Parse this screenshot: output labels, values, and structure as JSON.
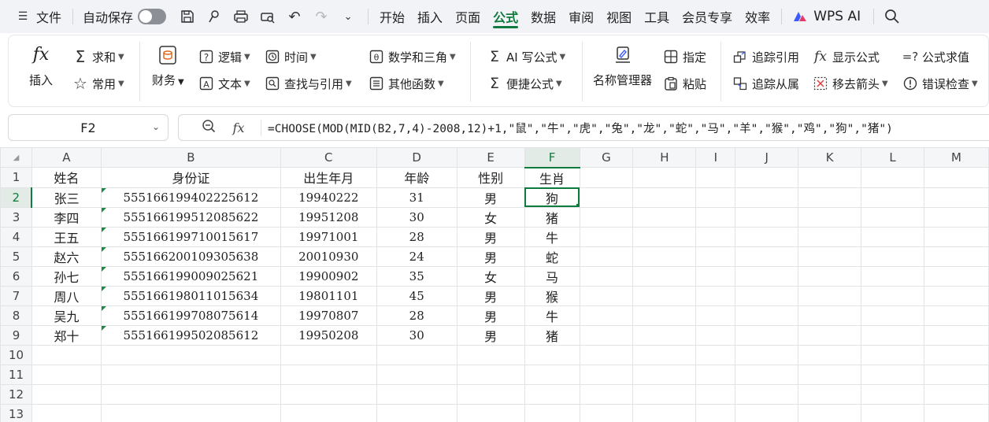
{
  "menubar": {
    "file_label": "文件",
    "autosave_label": "自动保存",
    "tabs": [
      "开始",
      "插入",
      "页面",
      "公式",
      "数据",
      "审阅",
      "视图",
      "工具",
      "会员专享",
      "效率"
    ],
    "active_tab": "公式",
    "wps_ai_label": "WPS AI"
  },
  "ribbon": {
    "insert_label": "插入",
    "sum_label": "求和",
    "common_label": "常用",
    "finance_label": "财务",
    "logic_label": "逻辑",
    "text_label": "文本",
    "time_label": "时间",
    "lookup_label": "查找与引用",
    "math_label": "数学和三角",
    "other_label": "其他函数",
    "ai_formula_label": "AI 写公式",
    "quick_formula_label": "便捷公式",
    "name_manager_label": "名称管理器",
    "specify_label": "指定",
    "paste_label": "粘贴",
    "trace_precedents_label": "追踪引用",
    "trace_dependents_label": "追踪从属",
    "show_formula_label": "显示公式",
    "remove_arrows_label": "移去箭头",
    "eval_formula_label": "公式求值",
    "error_check_label": "错误检查"
  },
  "formula_bar": {
    "name_box": "F2",
    "formula": "=CHOOSE(MOD(MID(B2,7,4)-2008,12)+1,\"鼠\",\"牛\",\"虎\",\"兔\",\"龙\",\"蛇\",\"马\",\"羊\",\"猴\",\"鸡\",\"狗\",\"猪\")"
  },
  "sheet": {
    "columns": [
      "A",
      "B",
      "C",
      "D",
      "E",
      "F",
      "G",
      "H",
      "I",
      "J",
      "K",
      "L",
      "M"
    ],
    "row_numbers": [
      "1",
      "2",
      "3",
      "4",
      "5",
      "6",
      "7",
      "8",
      "9",
      "10",
      "11",
      "12",
      "13"
    ],
    "headers": [
      "姓名",
      "身份证",
      "出生年月",
      "年龄",
      "性别",
      "生肖"
    ],
    "rows": [
      [
        "张三",
        "555166199402225612",
        "19940222",
        "31",
        "男",
        "狗"
      ],
      [
        "李四",
        "555166199512085622",
        "19951208",
        "30",
        "女",
        "猪"
      ],
      [
        "王五",
        "555166199710015617",
        "19971001",
        "28",
        "男",
        "牛"
      ],
      [
        "赵六",
        "555166200109305638",
        "20010930",
        "24",
        "男",
        "蛇"
      ],
      [
        "孙七",
        "555166199009025621",
        "19900902",
        "35",
        "女",
        "马"
      ],
      [
        "周八",
        "555166198011015634",
        "19801101",
        "45",
        "男",
        "猴"
      ],
      [
        "吴九",
        "555166199708075614",
        "19970807",
        "28",
        "男",
        "牛"
      ],
      [
        "郑十",
        "555166199502085612",
        "19950208",
        "30",
        "男",
        "猪"
      ]
    ],
    "selected_cell": "F2",
    "accent_color": "#0f7b3f"
  }
}
